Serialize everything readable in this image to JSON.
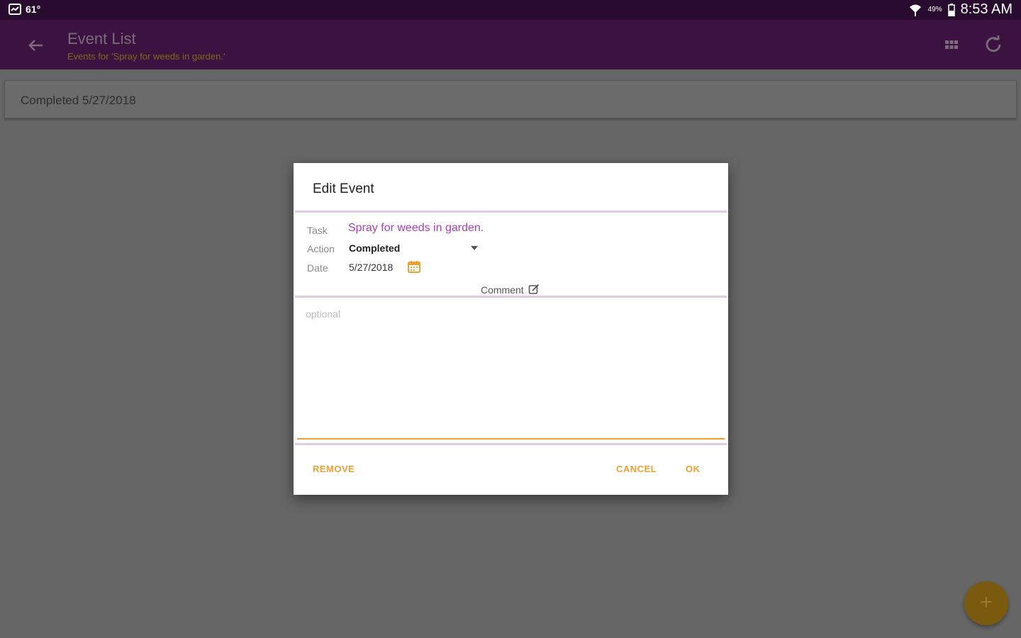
{
  "status_bar": {
    "temperature": "61°",
    "battery_percent": "49%",
    "time": "8:53 AM"
  },
  "app_bar": {
    "title": "Event List",
    "subtitle": "Events for 'Spray for weeds in garden.'"
  },
  "list": {
    "items": [
      {
        "text": "Completed 5/27/2018"
      }
    ]
  },
  "dialog": {
    "title": "Edit Event",
    "task_label": "Task",
    "task_value": "Spray for weeds in garden.",
    "action_label": "Action",
    "action_value": "Completed",
    "date_label": "Date",
    "date_value": "5/27/2018",
    "comment_label": "Comment",
    "comment_placeholder": "optional",
    "comment_value": "",
    "buttons": {
      "remove": "REMOVE",
      "cancel": "CANCEL",
      "ok": "OK"
    }
  },
  "fab": {
    "label": "+"
  },
  "colors": {
    "status_bar": "#2a0b30",
    "app_bar": "#3c1240",
    "accent": "#f0a030",
    "task_text": "#a63fbf",
    "separator": "#e6c8ec",
    "scrim_background": "#666666"
  }
}
